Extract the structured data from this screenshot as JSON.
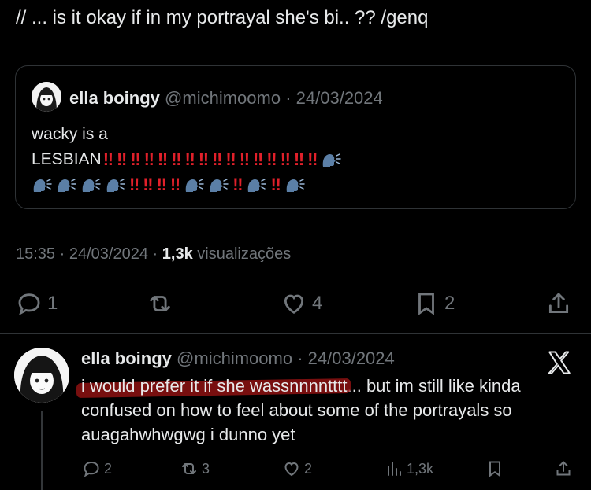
{
  "main_tweet": {
    "text": "// ... is it okay if in my portrayal she's bi.. ??  /genq"
  },
  "quoted_tweet": {
    "display_name": "ella boingy",
    "handle": "@michimoomo",
    "separator": "·",
    "date": "24/03/2024",
    "line1": "wacky is a",
    "line2": "LESBIAN",
    "bang": "‼",
    "emoji_sequence_row2": [
      "bang",
      "bang",
      "bang",
      "bang",
      "bang",
      "bang",
      "bang",
      "bang",
      "bang",
      "bang",
      "bang",
      "bang",
      "bang",
      "bang",
      "bang",
      "bang",
      "speak"
    ],
    "emoji_sequence_row3": [
      "speak",
      "speak",
      "speak",
      "speak",
      "bang",
      "bang",
      "bang",
      "bang",
      "speak",
      "speak",
      "bang",
      "speak",
      "bang",
      "speak"
    ]
  },
  "meta": {
    "time": "15:35",
    "separator": "·",
    "date": "24/03/2024",
    "separator2": "·",
    "views_count": "1,3k",
    "views_label": "visualizações"
  },
  "actions": {
    "replies": "1",
    "retweets": "",
    "likes": "4",
    "bookmarks": "2"
  },
  "reply": {
    "display_name": "ella boingy",
    "handle": "@michimoomo",
    "separator": "·",
    "date": "24/03/2024",
    "text_highlighted": "i would prefer it if she wassnnnntttt",
    "text_rest": "... but im still like kinda confused on how to feel about some of the portrayals so auagahwhwgwg i dunno yet",
    "replies": "2",
    "retweets": "3",
    "likes": "2",
    "views": "1,3k"
  },
  "colors": {
    "background": "#000000",
    "text": "#e7e9ea",
    "muted": "#71767b",
    "border": "#2f3336",
    "highlight": "#a01414",
    "bang": "#e0202a"
  },
  "icons": [
    "reply-icon",
    "retweet-icon",
    "heart-icon",
    "bookmark-icon",
    "share-icon",
    "views-icon",
    "x-logo-icon",
    "speaking-head-icon",
    "double-exclamation-icon"
  ]
}
